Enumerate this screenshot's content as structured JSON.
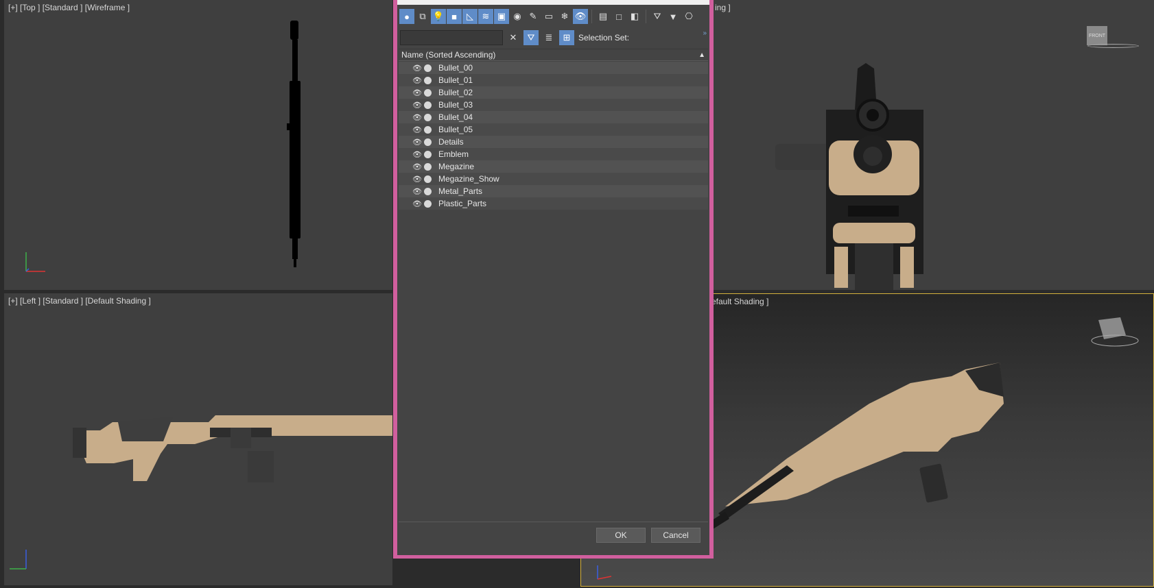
{
  "viewports": {
    "top_label": "[+] [Top ] [Standard ] [Wireframe ]",
    "front_label_partial": "ing ]",
    "left_label": "[+] [Left ] [Standard ] [Default Shading ]",
    "persp_label_partial": "efault Shading ]",
    "viewcube_label": "FRONT"
  },
  "dialog": {
    "selection_set_label": "Selection Set:",
    "search_value": "",
    "column_header": "Name (Sorted Ascending)",
    "sort_arrow": "▲",
    "items": [
      {
        "name": "Bullet_00"
      },
      {
        "name": "Bullet_01"
      },
      {
        "name": "Bullet_02"
      },
      {
        "name": "Bullet_03"
      },
      {
        "name": "Bullet_04"
      },
      {
        "name": "Bullet_05"
      },
      {
        "name": "Details"
      },
      {
        "name": "Emblem"
      },
      {
        "name": "Megazine"
      },
      {
        "name": "Megazine_Show"
      },
      {
        "name": "Metal_Parts"
      },
      {
        "name": "Plastic_Parts"
      }
    ],
    "ok_label": "OK",
    "cancel_label": "Cancel",
    "more_glyph": "»"
  },
  "colors": {
    "dialog_border": "#d15f9e",
    "toggle_on": "#5f8cc8",
    "active_viewport_border": "#d5b23c",
    "gun_tan": "#c8ad8a"
  }
}
